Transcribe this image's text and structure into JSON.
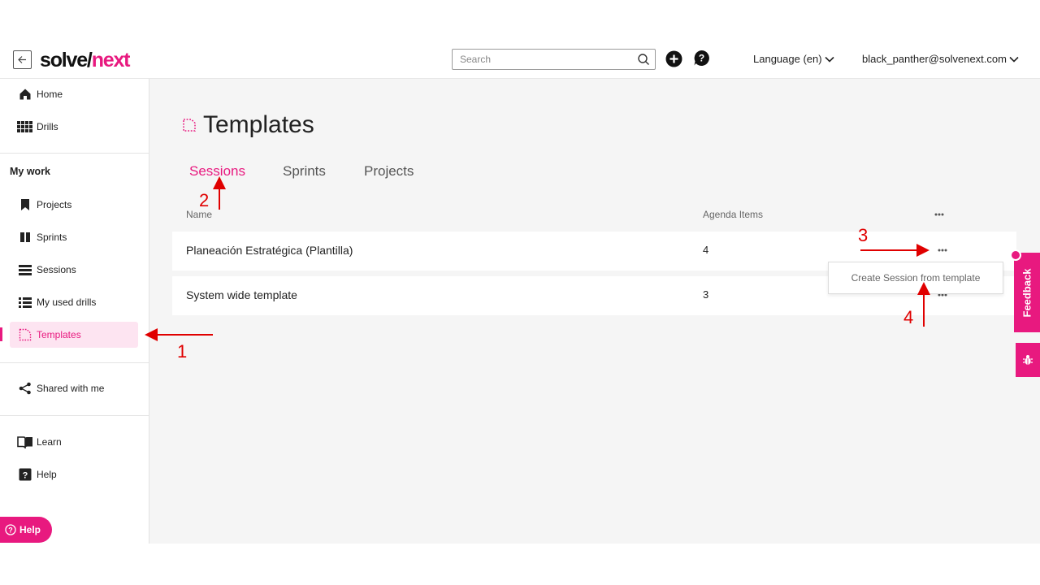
{
  "header": {
    "logo_part1": "solve/",
    "logo_part2": "next",
    "search_placeholder": "Search",
    "language_label": "Language (en)",
    "user_email": "black_panther@solvenext.com"
  },
  "sidebar": {
    "home": "Home",
    "drills": "Drills",
    "section_my_work": "My work",
    "projects": "Projects",
    "sprints": "Sprints",
    "sessions": "Sessions",
    "my_used_drills": "My used drills",
    "templates": "Templates",
    "shared_with_me": "Shared with me",
    "learn": "Learn",
    "help": "Help",
    "help_pill": "Help"
  },
  "main": {
    "title": "Templates",
    "tabs": [
      {
        "label": "Sessions",
        "active": true
      },
      {
        "label": "Sprints",
        "active": false
      },
      {
        "label": "Projects",
        "active": false
      }
    ],
    "columns": {
      "name": "Name",
      "agenda_items": "Agenda Items"
    },
    "rows": [
      {
        "name": "Planeación Estratégica (Plantilla)",
        "agenda_items": "4"
      },
      {
        "name": "System wide template",
        "agenda_items": "3"
      }
    ],
    "context_menu_item": "Create Session from template"
  },
  "feedback_label": "Feedback",
  "annotations": [
    "1",
    "2",
    "3",
    "4"
  ],
  "colors": {
    "accent": "#e8197f",
    "annotation": "#e00000"
  }
}
